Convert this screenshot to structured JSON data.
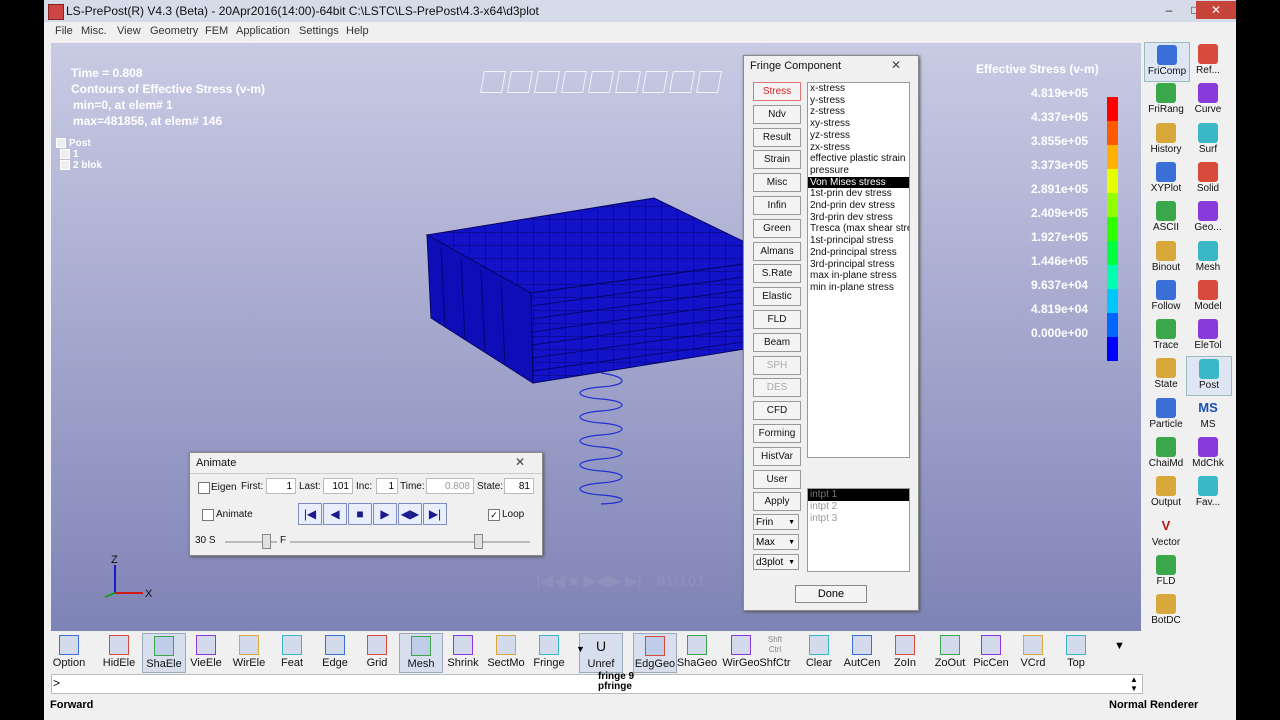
{
  "window": {
    "title": "LS-PrePost(R) V4.3 (Beta) - 20Apr2016(14:00)-64bit C:\\LSTC\\LS-PrePost\\4.3-x64\\d3plot",
    "min_label": "–",
    "max_label": "□",
    "close_label": "✕"
  },
  "menu": [
    "File",
    "Misc.",
    "View",
    "Geometry",
    "FEM",
    "Application",
    "Settings",
    "Help"
  ],
  "viewport": {
    "hud": [
      "Time =      0.808",
      "Contours of Effective Stress (v-m)",
      "min=0, at elem# 1",
      "max=481856, at elem# 146"
    ],
    "tree": [
      "Post",
      "1",
      "2 blok"
    ],
    "legend": {
      "title": "Effective Stress (v-m)",
      "values": [
        "4.819e+05",
        "4.337e+05",
        "3.855e+05",
        "3.373e+05",
        "2.891e+05",
        "2.409e+05",
        "1.927e+05",
        "1.446e+05",
        "9.637e+04",
        "4.819e+04",
        "0.000e+00"
      ],
      "colors": [
        "#ff0000",
        "#ff5a00",
        "#ffb000",
        "#e6ff00",
        "#90ff00",
        "#30ff00",
        "#00ff40",
        "#00ffb0",
        "#00c8ff",
        "#0066ff",
        "#0000ff"
      ]
    },
    "axes": {
      "z": "Z",
      "x": "X"
    },
    "state_counter": "81/101",
    "colors": {
      "mesh": "#1010c8",
      "spring": "#2030d0"
    }
  },
  "fringe": {
    "title": "Fringe Component",
    "buttons": [
      "Stress",
      "Ndv",
      "Result",
      "Strain",
      "Misc",
      "Infin",
      "Green",
      "Almans",
      "S.Rate",
      "Elastic",
      "FLD",
      "Beam",
      "SPH",
      "DES",
      "CFD",
      "Forming",
      "HistVar",
      "User",
      "Apply"
    ],
    "active_button": "Stress",
    "disabled_buttons": [
      "SPH",
      "DES"
    ],
    "selects": [
      "Frin",
      "Max",
      "d3plot"
    ],
    "components": [
      "x-stress",
      "y-stress",
      "z-stress",
      "xy-stress",
      "yz-stress",
      "zx-stress",
      "effective plastic strain",
      "pressure",
      "Von Mises stress",
      "1st-prin dev stress",
      "2nd-prin dev stress",
      "3rd-prin dev stress",
      "Tresca (max shear stress)",
      "1st-principal stress",
      "2nd-principal stress",
      "3rd-principal stress",
      "max in-plane stress",
      "min in-plane stress"
    ],
    "selected_component": "Von Mises stress",
    "intpts": [
      "intpt  1",
      "intpt  2",
      "intpt  3"
    ],
    "done": "Done"
  },
  "animate": {
    "title": "Animate",
    "eigen_label": "Eigen",
    "first_label": "First:",
    "first": "1",
    "last_label": "Last:",
    "last": "101",
    "inc_label": "Inc:",
    "inc": "1",
    "time_label": "Time:",
    "time": "0.808",
    "state_label": "State:",
    "state": "81",
    "animate_label": "Animate",
    "loop_label": "Loop",
    "speed_left": "30  S",
    "speed_right": "F"
  },
  "right_toolbar": [
    [
      "FriComp",
      "Ref..."
    ],
    [
      "FriRang",
      "Curve"
    ],
    [
      "History",
      "Surf"
    ],
    [
      "XYPlot",
      "Solid"
    ],
    [
      "ASCII",
      "Geo..."
    ],
    [
      "Binout",
      "Mesh"
    ],
    [
      "Follow",
      "Model"
    ],
    [
      "Trace",
      "EleTol"
    ],
    [
      "State",
      "Post"
    ],
    [
      "Particle",
      "MS"
    ],
    [
      "ChaiMd",
      "MdChk"
    ],
    [
      "Output",
      "Fav..."
    ],
    [
      "Vector",
      ""
    ],
    [
      "FLD",
      ""
    ],
    [
      "BotDC",
      ""
    ]
  ],
  "right_icon_text": {
    "ms": "MS",
    "vector": "V"
  },
  "bottom_toolbar": [
    "Option",
    "HidEle",
    "ShaEle",
    "VieEle",
    "WirEle",
    "Feat",
    "Edge",
    "Grid",
    "Mesh",
    "Shrink",
    "SectMo",
    "Fringe",
    "Unref",
    "EdgGeo",
    "ShaGeo",
    "WirGeo",
    "ShfCtr",
    "Clear",
    "AutCen",
    "ZoIn",
    "ZoOut",
    "PicCen",
    "VCrd",
    "Top"
  ],
  "bottom_icon_text": {
    "unref": "U",
    "shfctr": "Shft Ctrl"
  },
  "command": {
    "prompt": ">",
    "history": [
      "fringe 9",
      "pfringe"
    ]
  },
  "status": {
    "left": "Forward",
    "right": "Normal Renderer"
  }
}
